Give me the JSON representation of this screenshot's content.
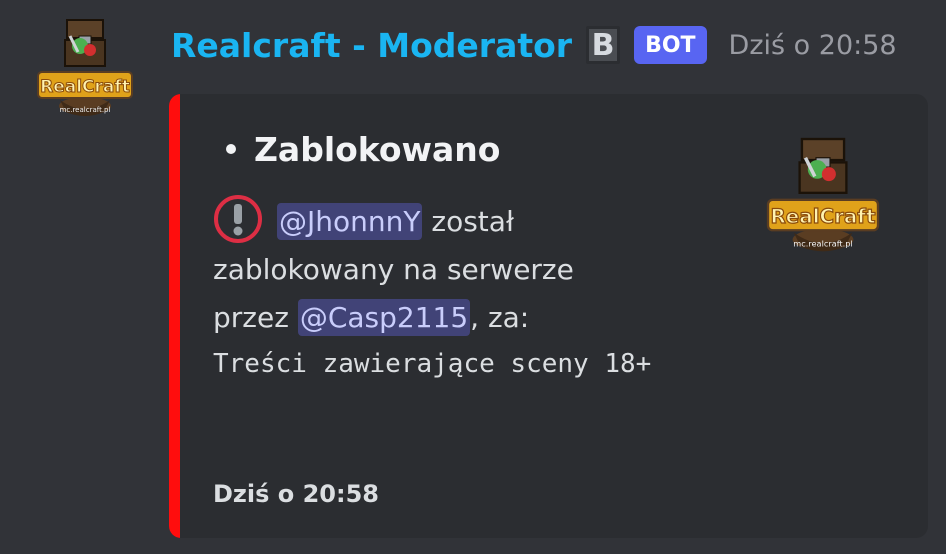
{
  "message": {
    "author": {
      "username": "Realcraft - Moderator",
      "role_badge": "B",
      "bot_tag": "BOT",
      "avatar_icon": "realcraft-logo",
      "name_color": "#1ab5f2"
    },
    "timestamp": "Dziś o 20:58"
  },
  "embed": {
    "accent_color": "#ff0d0d",
    "title": "Zablokowano",
    "thumbnail_icon": "realcraft-logo",
    "logo_text": "RealCraft",
    "logo_subtext": "mc.realcraft.pl",
    "description": {
      "warning_icon": "exclamation-circle-icon",
      "banned_user_mention": "@JhonnnY",
      "text_after_user": " został",
      "line2": "zablokowany na serwerze",
      "text_before_moderator": "przez ",
      "moderator_mention": "@Casp2115",
      "text_after_moderator": ", za:",
      "reason": "Treści zawierające sceny 18+"
    },
    "footer": "Dziś o 20:58"
  }
}
